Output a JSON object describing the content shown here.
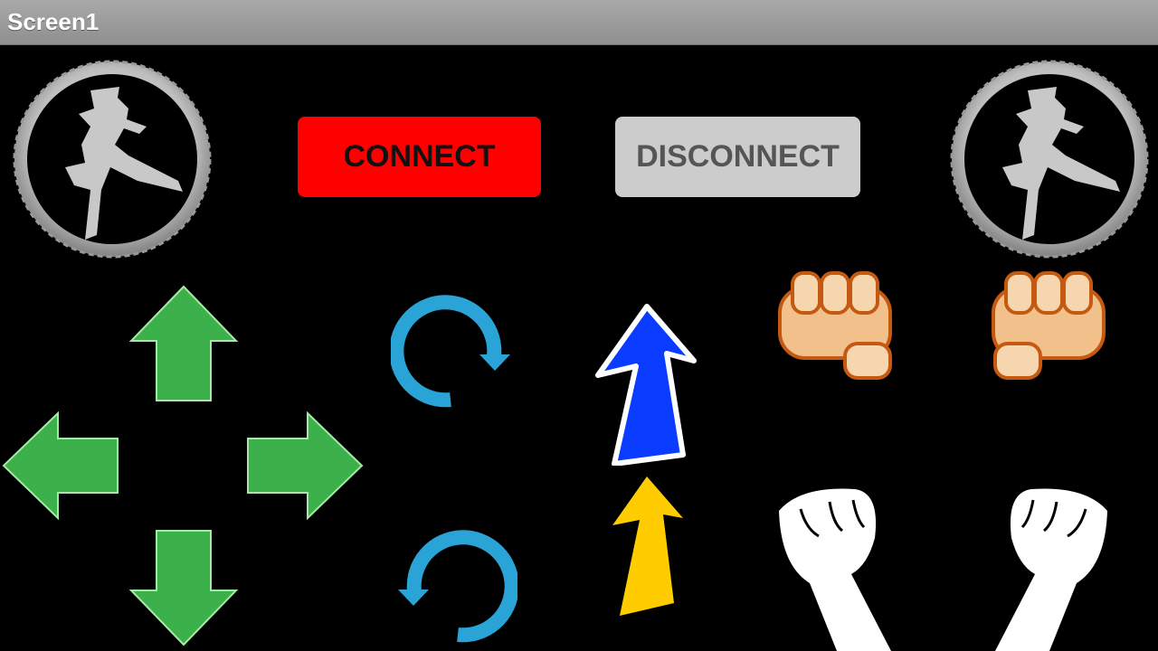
{
  "window": {
    "title": "Screen1"
  },
  "buttons": {
    "connect": {
      "label": "CONNECT",
      "color": "#ff0000"
    },
    "disconnect": {
      "label": "DISCONNECT",
      "color": "#cccccc"
    }
  },
  "logos": {
    "left": "gear-logo-icon",
    "right": "gear-logo-icon"
  },
  "controls": {
    "dpad": [
      "arrow-up-icon",
      "arrow-left-icon",
      "arrow-right-icon",
      "arrow-down-icon"
    ],
    "rotate": [
      "rotate-clockwise-icon",
      "rotate-counterclockwise-icon"
    ],
    "speed": [
      "blue-arrow-up-icon",
      "yellow-arrow-up-icon"
    ],
    "punch": [
      "fist-punch-left-icon",
      "fist-punch-right-icon"
    ],
    "raise": [
      "raised-fist-left-icon",
      "raised-fist-right-icon"
    ]
  },
  "colors": {
    "dpad_green": "#3cb04a",
    "rotate_blue": "#2aa3d6",
    "speed_blue": "#0a3cff",
    "speed_yellow": "#ffcc00",
    "fist_skin": "#f2c08a"
  }
}
